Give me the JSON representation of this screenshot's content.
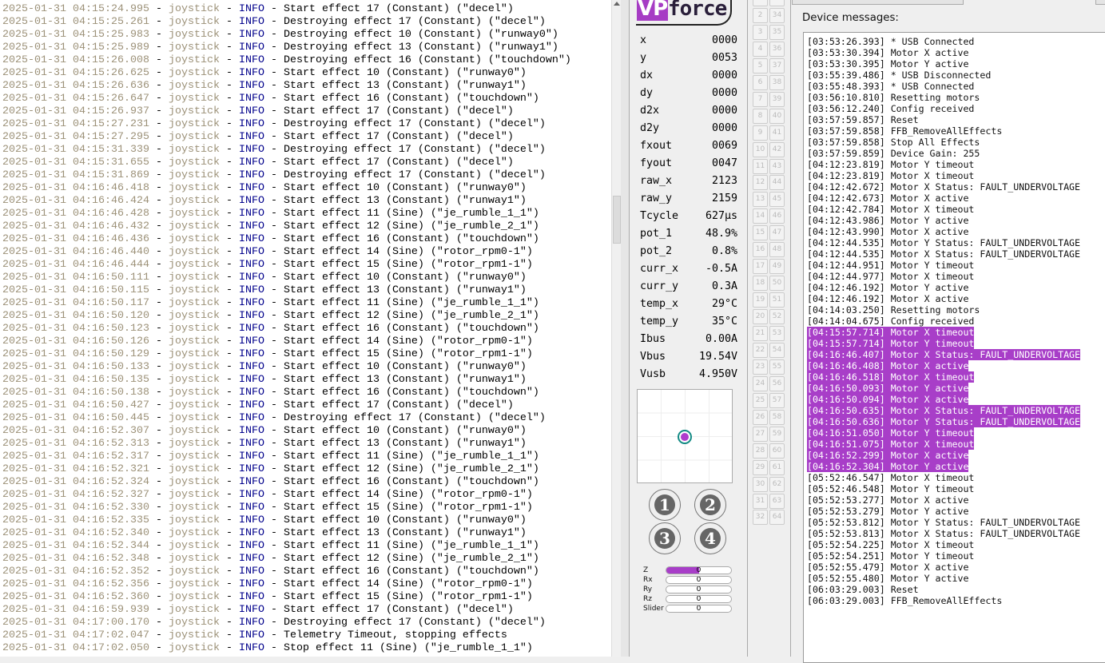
{
  "log": {
    "source": "joystick",
    "level": "INFO",
    "rows": [
      [
        "2025-01-31 04:15:24.995",
        "Start effect 17 (Constant) (\"decel\")"
      ],
      [
        "2025-01-31 04:15:25.261",
        "Destroying effect 17 (Constant) (\"decel\")"
      ],
      [
        "2025-01-31 04:15:25.983",
        "Destroying effect 10 (Constant) (\"runway0\")"
      ],
      [
        "2025-01-31 04:15:25.989",
        "Destroying effect 13 (Constant) (\"runway1\")"
      ],
      [
        "2025-01-31 04:15:26.008",
        "Destroying effect 16 (Constant) (\"touchdown\")"
      ],
      [
        "2025-01-31 04:15:26.625",
        "Start effect 10 (Constant) (\"runway0\")"
      ],
      [
        "2025-01-31 04:15:26.636",
        "Start effect 13 (Constant) (\"runway1\")"
      ],
      [
        "2025-01-31 04:15:26.647",
        "Start effect 16 (Constant) (\"touchdown\")"
      ],
      [
        "2025-01-31 04:15:26.937",
        "Start effect 17 (Constant) (\"decel\")"
      ],
      [
        "2025-01-31 04:15:27.231",
        "Destroying effect 17 (Constant) (\"decel\")"
      ],
      [
        "2025-01-31 04:15:27.295",
        "Start effect 17 (Constant) (\"decel\")"
      ],
      [
        "2025-01-31 04:15:31.339",
        "Destroying effect 17 (Constant) (\"decel\")"
      ],
      [
        "2025-01-31 04:15:31.655",
        "Start effect 17 (Constant) (\"decel\")"
      ],
      [
        "2025-01-31 04:15:31.869",
        "Destroying effect 17 (Constant) (\"decel\")"
      ],
      [
        "2025-01-31 04:16:46.418",
        "Start effect 10 (Constant) (\"runway0\")"
      ],
      [
        "2025-01-31 04:16:46.424",
        "Start effect 13 (Constant) (\"runway1\")"
      ],
      [
        "2025-01-31 04:16:46.428",
        "Start effect 11 (Sine) (\"je_rumble_1_1\")"
      ],
      [
        "2025-01-31 04:16:46.432",
        "Start effect 12 (Sine) (\"je_rumble_2_1\")"
      ],
      [
        "2025-01-31 04:16:46.436",
        "Start effect 16 (Constant) (\"touchdown\")"
      ],
      [
        "2025-01-31 04:16:46.440",
        "Start effect 14 (Sine) (\"rotor_rpm0-1\")"
      ],
      [
        "2025-01-31 04:16:46.444",
        "Start effect 15 (Sine) (\"rotor_rpm1-1\")"
      ],
      [
        "2025-01-31 04:16:50.111",
        "Start effect 10 (Constant) (\"runway0\")"
      ],
      [
        "2025-01-31 04:16:50.115",
        "Start effect 13 (Constant) (\"runway1\")"
      ],
      [
        "2025-01-31 04:16:50.117",
        "Start effect 11 (Sine) (\"je_rumble_1_1\")"
      ],
      [
        "2025-01-31 04:16:50.120",
        "Start effect 12 (Sine) (\"je_rumble_2_1\")"
      ],
      [
        "2025-01-31 04:16:50.123",
        "Start effect 16 (Constant) (\"touchdown\")"
      ],
      [
        "2025-01-31 04:16:50.126",
        "Start effect 14 (Sine) (\"rotor_rpm0-1\")"
      ],
      [
        "2025-01-31 04:16:50.129",
        "Start effect 15 (Sine) (\"rotor_rpm1-1\")"
      ],
      [
        "2025-01-31 04:16:50.133",
        "Start effect 10 (Constant) (\"runway0\")"
      ],
      [
        "2025-01-31 04:16:50.135",
        "Start effect 13 (Constant) (\"runway1\")"
      ],
      [
        "2025-01-31 04:16:50.138",
        "Start effect 16 (Constant) (\"touchdown\")"
      ],
      [
        "2025-01-31 04:16:50.427",
        "Start effect 17 (Constant) (\"decel\")"
      ],
      [
        "2025-01-31 04:16:50.445",
        "Destroying effect 17 (Constant) (\"decel\")"
      ],
      [
        "2025-01-31 04:16:52.307",
        "Start effect 10 (Constant) (\"runway0\")"
      ],
      [
        "2025-01-31 04:16:52.313",
        "Start effect 13 (Constant) (\"runway1\")"
      ],
      [
        "2025-01-31 04:16:52.317",
        "Start effect 11 (Sine) (\"je_rumble_1_1\")"
      ],
      [
        "2025-01-31 04:16:52.321",
        "Start effect 12 (Sine) (\"je_rumble_2_1\")"
      ],
      [
        "2025-01-31 04:16:52.324",
        "Start effect 16 (Constant) (\"touchdown\")"
      ],
      [
        "2025-01-31 04:16:52.327",
        "Start effect 14 (Sine) (\"rotor_rpm0-1\")"
      ],
      [
        "2025-01-31 04:16:52.330",
        "Start effect 15 (Sine) (\"rotor_rpm1-1\")"
      ],
      [
        "2025-01-31 04:16:52.335",
        "Start effect 10 (Constant) (\"runway0\")"
      ],
      [
        "2025-01-31 04:16:52.340",
        "Start effect 13 (Constant) (\"runway1\")"
      ],
      [
        "2025-01-31 04:16:52.344",
        "Start effect 11 (Sine) (\"je_rumble_1_1\")"
      ],
      [
        "2025-01-31 04:16:52.348",
        "Start effect 12 (Sine) (\"je_rumble_2_1\")"
      ],
      [
        "2025-01-31 04:16:52.352",
        "Start effect 16 (Constant) (\"touchdown\")"
      ],
      [
        "2025-01-31 04:16:52.356",
        "Start effect 14 (Sine) (\"rotor_rpm0-1\")"
      ],
      [
        "2025-01-31 04:16:52.360",
        "Start effect 15 (Sine) (\"rotor_rpm1-1\")"
      ],
      [
        "2025-01-31 04:16:59.939",
        "Start effect 17 (Constant) (\"decel\")"
      ],
      [
        "2025-01-31 04:17:00.170",
        "Destroying effect 17 (Constant) (\"decel\")"
      ],
      [
        "2025-01-31 04:17:02.047",
        "Telemetry Timeout, stopping effects"
      ],
      [
        "2025-01-31 04:17:02.050",
        "Stop effect 11 (Sine) (\"je_rumble_1_1\")"
      ]
    ]
  },
  "vpforce": {
    "logo": "VPforce",
    "stats": [
      [
        "x",
        "0000"
      ],
      [
        "y",
        "0053"
      ],
      [
        "dx",
        "0000"
      ],
      [
        "dy",
        "0000"
      ],
      [
        "d2x",
        "0000"
      ],
      [
        "d2y",
        "0000"
      ],
      [
        "fxout",
        "0069"
      ],
      [
        "fyout",
        "0047"
      ],
      [
        "raw_x",
        "2123"
      ],
      [
        "raw_y",
        "2159"
      ],
      [
        "Tcycle",
        "627μs"
      ],
      [
        "pot_1",
        "48.9%"
      ],
      [
        "pot_2",
        "0.8%"
      ],
      [
        "curr_x",
        "-0.5A"
      ],
      [
        "curr_y",
        "0.3A"
      ],
      [
        "temp_x",
        "29°C"
      ],
      [
        "temp_y",
        "35°C"
      ],
      [
        "Ibus",
        "0.00A"
      ],
      [
        "Vbus",
        "19.54V"
      ],
      [
        "Vusb",
        "4.950V"
      ]
    ],
    "buttons": [
      "1",
      "2",
      "3",
      "4"
    ],
    "axes": [
      {
        "label": "Z",
        "value": "0",
        "fill": 0.5
      },
      {
        "label": "Rx",
        "value": "0",
        "fill": 0
      },
      {
        "label": "Ry",
        "value": "0",
        "fill": 0
      },
      {
        "label": "Rz",
        "value": "0",
        "fill": 0
      },
      {
        "label": "Slider",
        "value": "0",
        "fill": 0
      }
    ],
    "accent": "#a83ec8"
  },
  "button_grid": {
    "count": 64
  },
  "messages": {
    "label": "Device messages:",
    "highlight_color": "#a83ec8",
    "rows": [
      {
        "t": "[03:53:26.393] * USB Connected"
      },
      {
        "t": "[03:53:30.394] Motor X active"
      },
      {
        "t": "[03:53:30.395] Motor Y active"
      },
      {
        "t": "[03:55:39.486] * USB Disconnected"
      },
      {
        "t": "[03:55:48.393] * USB Connected"
      },
      {
        "t": "[03:56:10.810] Resetting motors"
      },
      {
        "t": "[03:56:12.240] Config received"
      },
      {
        "t": "[03:57:59.857] Reset"
      },
      {
        "t": "[03:57:59.858] FFB_RemoveAllEffects"
      },
      {
        "t": "[03:57:59.858] Stop All Effects"
      },
      {
        "t": "[03:57:59.859] Device Gain: 255"
      },
      {
        "t": "[04:12:23.819] Motor Y timeout"
      },
      {
        "t": "[04:12:23.819] Motor X timeout"
      },
      {
        "t": "[04:12:42.672] Motor X Status: FAULT_UNDERVOLTAGE"
      },
      {
        "t": "[04:12:42.673] Motor X active"
      },
      {
        "t": "[04:12:42.784] Motor X timeout"
      },
      {
        "t": "[04:12:43.986] Motor Y active"
      },
      {
        "t": "[04:12:43.990] Motor X active"
      },
      {
        "t": "[04:12:44.535] Motor Y Status: FAULT_UNDERVOLTAGE"
      },
      {
        "t": "[04:12:44.535] Motor X Status: FAULT_UNDERVOLTAGE"
      },
      {
        "t": "[04:12:44.951] Motor Y timeout"
      },
      {
        "t": "[04:12:44.977] Motor X timeout"
      },
      {
        "t": "[04:12:46.192] Motor Y active"
      },
      {
        "t": "[04:12:46.192] Motor X active"
      },
      {
        "t": "[04:14:03.250] Resetting motors"
      },
      {
        "t": "[04:14:04.675] Config received"
      },
      {
        "t": "[04:15:57.714] Motor X timeout",
        "sel": true
      },
      {
        "t": "[04:15:57.714] Motor Y timeout",
        "sel": true
      },
      {
        "t": "[04:16:46.407] Motor X Status: FAULT_UNDERVOLTAGE",
        "sel": true
      },
      {
        "t": "[04:16:46.408] Motor X active",
        "sel": true
      },
      {
        "t": "[04:16:46.518] Motor X timeout",
        "sel": true
      },
      {
        "t": "[04:16:50.093] Motor Y active",
        "sel": true
      },
      {
        "t": "[04:16:50.094] Motor X active",
        "sel": true
      },
      {
        "t": "[04:16:50.635] Motor X Status: FAULT_UNDERVOLTAGE",
        "sel": true
      },
      {
        "t": "[04:16:50.636] Motor Y Status: FAULT_UNDERVOLTAGE",
        "sel": true
      },
      {
        "t": "[04:16:51.050] Motor Y timeout",
        "sel": true
      },
      {
        "t": "[04:16:51.075] Motor X timeout",
        "sel": true
      },
      {
        "t": "[04:16:52.299] Motor X active",
        "sel": true
      },
      {
        "t": "[04:16:52.304] Motor Y active",
        "sel": true
      },
      {
        "t": "[05:52:46.547] Motor X timeout"
      },
      {
        "t": "[05:52:46.548] Motor Y timeout"
      },
      {
        "t": "[05:52:53.277] Motor X active"
      },
      {
        "t": "[05:52:53.279] Motor Y active"
      },
      {
        "t": "[05:52:53.812] Motor Y Status: FAULT_UNDERVOLTAGE"
      },
      {
        "t": "[05:52:53.813] Motor X Status: FAULT_UNDERVOLTAGE"
      },
      {
        "t": "[05:52:54.225] Motor X timeout"
      },
      {
        "t": "[05:52:54.251] Motor Y timeout"
      },
      {
        "t": "[05:52:55.479] Motor X active"
      },
      {
        "t": "[05:52:55.480] Motor Y active"
      },
      {
        "t": "[06:03:29.003] Reset"
      },
      {
        "t": "[06:03:29.003] FFB_RemoveAllEffects"
      }
    ]
  }
}
